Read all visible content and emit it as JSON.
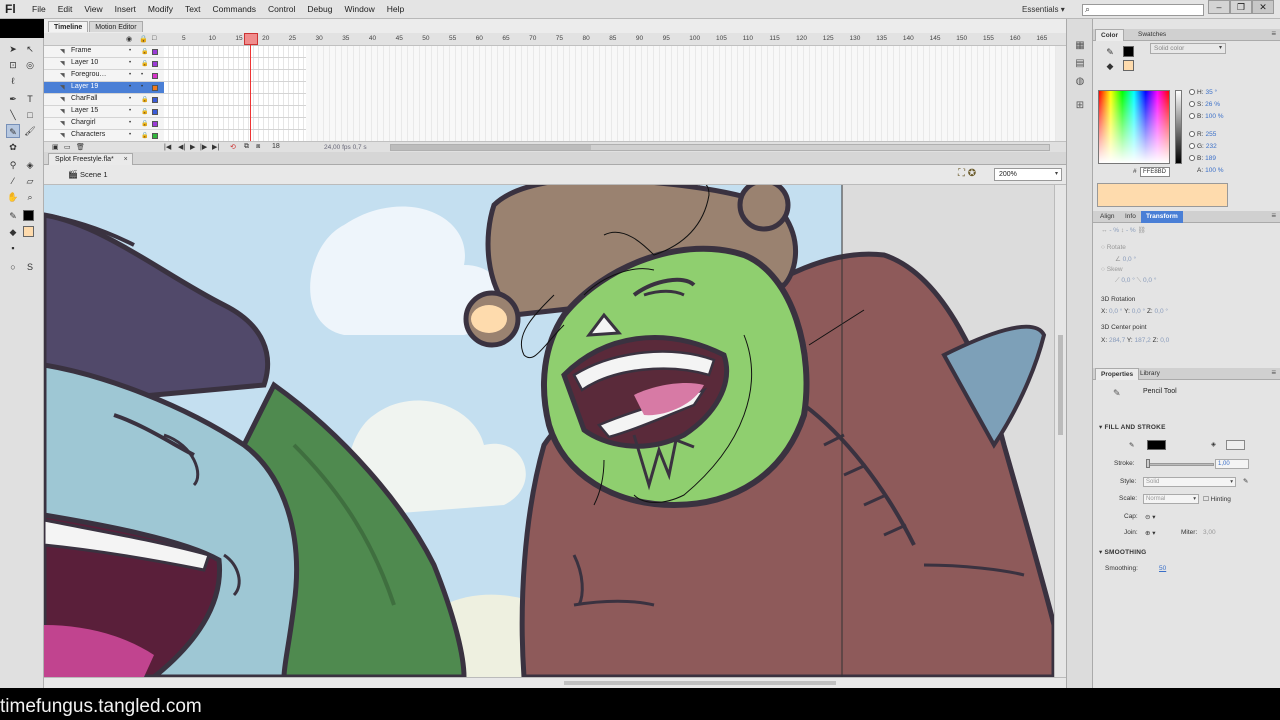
{
  "app": {
    "logo": "Fl",
    "workspace": "Essentials",
    "workspace_caret": "▾"
  },
  "menu": [
    "File",
    "Edit",
    "View",
    "Insert",
    "Modify",
    "Text",
    "Commands",
    "Control",
    "Debug",
    "Window",
    "Help"
  ],
  "window_controls": {
    "minimize": "–",
    "restore": "❐",
    "close": "✕"
  },
  "timeline": {
    "tabs": [
      "Timeline",
      "Motion Editor"
    ],
    "frame_numbers": [
      "5",
      "10",
      "15",
      "20",
      "25",
      "30",
      "35",
      "40",
      "45",
      "50",
      "55",
      "60",
      "65",
      "70",
      "75",
      "80",
      "85",
      "90",
      "95",
      "100",
      "105",
      "110",
      "115",
      "120",
      "125",
      "130",
      "135",
      "140",
      "145",
      "150",
      "155",
      "160",
      "165"
    ],
    "current_frame": "18",
    "layers": [
      {
        "name": "Frame",
        "color": "#9b3bd6"
      },
      {
        "name": "Layer 10",
        "color": "#9b3bd6"
      },
      {
        "name": "Foregrou…",
        "color": "#d633c9"
      },
      {
        "name": "Layer 19",
        "color": "#f07a1e",
        "selected": true
      },
      {
        "name": "CharFall",
        "color": "#3a5bd8"
      },
      {
        "name": "Layer 15",
        "color": "#3a5bd8"
      },
      {
        "name": "Chargirl",
        "color": "#9b3bd6"
      },
      {
        "name": "Characters",
        "color": "#2fb53a"
      }
    ],
    "fps": "24,00 fps",
    "time": "0,7 s"
  },
  "document": {
    "tab": "Splot Freestyle.fla*",
    "tab_close": "×",
    "scene": "Scene 1",
    "zoom": "200%"
  },
  "color_panel": {
    "tabs": [
      "Color",
      "Swatches"
    ],
    "color_type": "Solid color",
    "hsb": [
      {
        "label": "H:",
        "value": "35 °"
      },
      {
        "label": "S:",
        "value": "26 %"
      },
      {
        "label": "B:",
        "value": "100 %"
      }
    ],
    "rgb": [
      {
        "label": "R:",
        "value": "255"
      },
      {
        "label": "G:",
        "value": "232"
      },
      {
        "label": "B:",
        "value": "189"
      }
    ],
    "alpha": {
      "label": "A:",
      "value": "100 %"
    },
    "hex_label": "#",
    "hex": "FFE8BD",
    "preview_color": "#fedbad"
  },
  "transform_panel": {
    "tabs": [
      "Align",
      "Info",
      "Transform"
    ],
    "scale_w": "- %",
    "scale_h": "- %",
    "rotate_label": "Rotate",
    "rotate_value": "0,0 °",
    "skew_label": "Skew",
    "skew_x": "0,0 °",
    "skew_y": "0,0 °",
    "rotation_3d_label": "3D Rotation",
    "rot3d": {
      "x": "0,0 °",
      "y": "0,0 °",
      "z": "0,0 °"
    },
    "center_3d_label": "3D Center point",
    "center3d": {
      "x": "284,7",
      "y": "187,2",
      "z": "0,0"
    }
  },
  "properties_panel": {
    "tabs": [
      "Properties",
      "Library"
    ],
    "tool_name": "Pencil Tool",
    "fill_stroke_header": "FILL AND STROKE",
    "stroke_label": "Stroke:",
    "stroke_value": "1,00",
    "style_label": "Style:",
    "style_value": "Solid",
    "scale_label": "Scale:",
    "scale_value": "Normal",
    "hinting_label": "Hinting",
    "cap_label": "Cap:",
    "join_label": "Join:",
    "miter_label": "Miter:",
    "miter_value": "3,00",
    "smoothing_header": "SMOOTHING",
    "smoothing_label": "Smoothing:",
    "smoothing_value": "50"
  },
  "watermark": "timefungus.tangled.com"
}
